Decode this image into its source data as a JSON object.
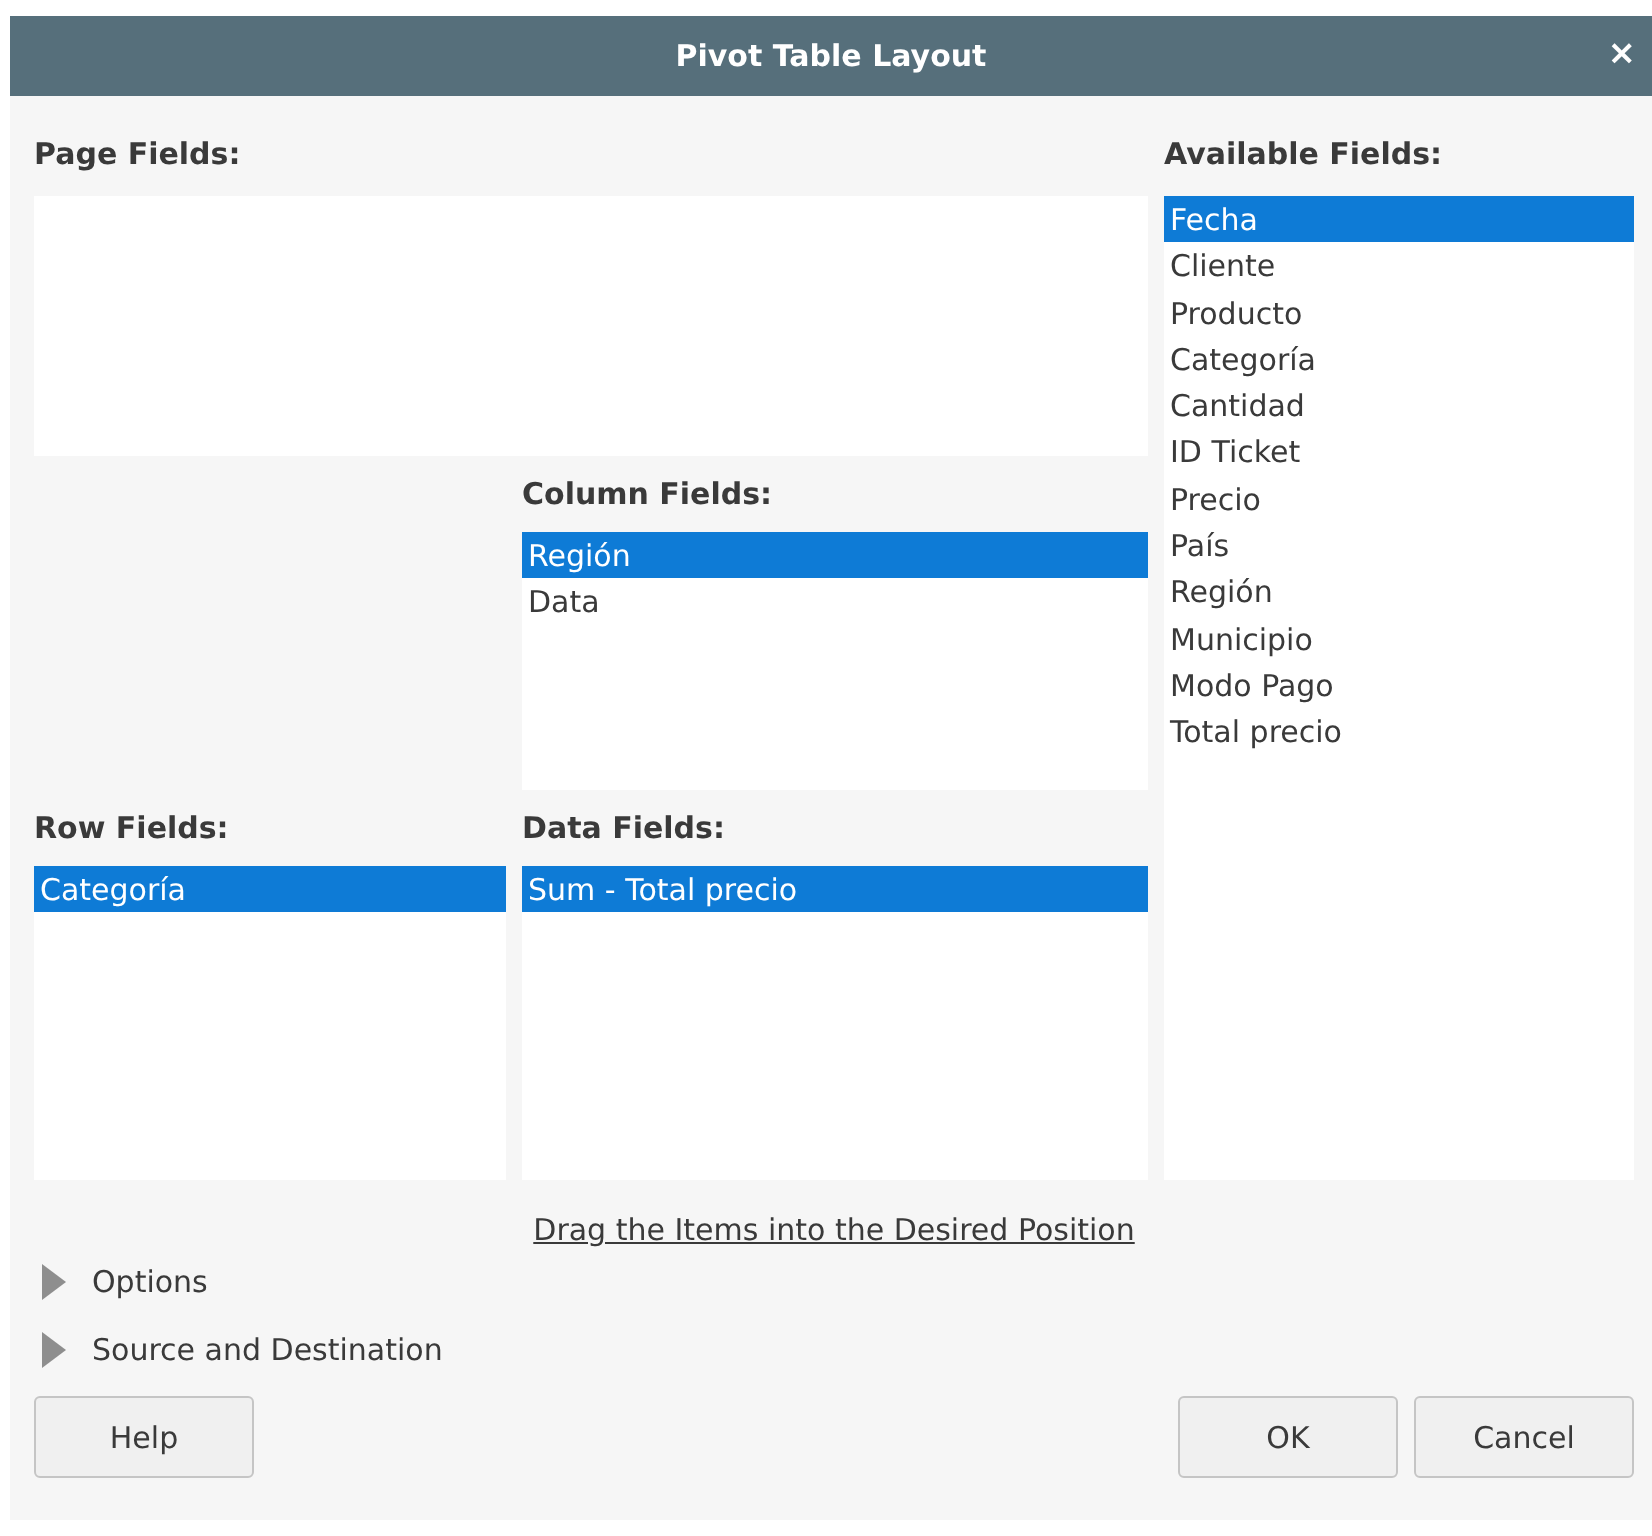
{
  "window": {
    "title": "Pivot Table Layout",
    "close": "×"
  },
  "page_fields": {
    "label": "Page Fields:"
  },
  "column_fields": {
    "label": "Column Fields:",
    "items": [
      {
        "label": "Región",
        "selected": true
      },
      {
        "label": "Data",
        "selected": false
      }
    ]
  },
  "row_fields": {
    "label": "Row Fields:",
    "items": [
      {
        "label": "Categoría",
        "selected": true
      }
    ]
  },
  "data_fields": {
    "label": "Data Fields:",
    "items": [
      {
        "label": "Sum - Total precio",
        "selected": true
      }
    ]
  },
  "available_fields": {
    "label": "Available Fields:",
    "items": [
      {
        "label": "Fecha",
        "selected": true
      },
      {
        "label": "Cliente",
        "selected": false
      },
      {
        "label": "Producto",
        "selected": false
      },
      {
        "label": "Categoría",
        "selected": false
      },
      {
        "label": "Cantidad",
        "selected": false
      },
      {
        "label": "ID Ticket",
        "selected": false
      },
      {
        "label": "Precio",
        "selected": false
      },
      {
        "label": "País",
        "selected": false
      },
      {
        "label": "Región",
        "selected": false
      },
      {
        "label": "Municipio",
        "selected": false
      },
      {
        "label": "Modo Pago",
        "selected": false
      },
      {
        "label": "Total precio",
        "selected": false
      }
    ]
  },
  "hint": "Drag the Items into the Desired Position",
  "expanders": [
    {
      "label": "Options",
      "expanded": false
    },
    {
      "label": "Source and Destination",
      "expanded": false
    }
  ],
  "buttons": {
    "help": "Help",
    "ok": "OK",
    "cancel": "Cancel"
  }
}
